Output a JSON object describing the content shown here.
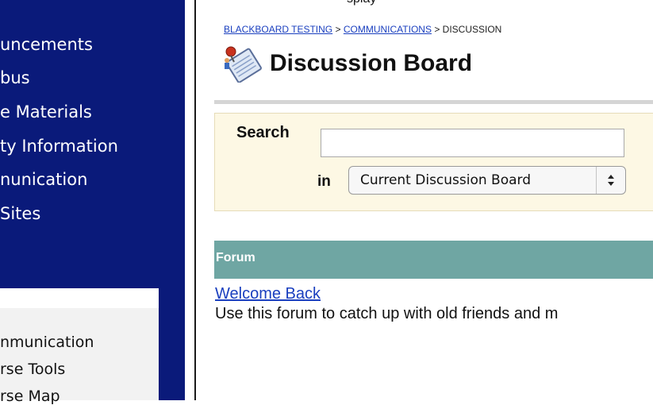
{
  "nav": {
    "items": [
      {
        "label": "uncements"
      },
      {
        "label": "bus"
      },
      {
        "label": "e Materials"
      },
      {
        "label": "ty Information"
      },
      {
        "label": "nunication"
      },
      {
        "label": "Sites"
      }
    ]
  },
  "tools": {
    "items": [
      {
        "label": "nmunication"
      },
      {
        "label": "rse Tools"
      },
      {
        "label": "rse Map"
      }
    ]
  },
  "top_cut": "splay",
  "breadcrumb": {
    "items": [
      "BLACKBOARD TESTING",
      "COMMUNICATIONS"
    ],
    "separator": ">",
    "current": "DISCUSSION"
  },
  "page": {
    "title": "Discussion Board",
    "icon": "discussion-board-icon"
  },
  "search": {
    "label": "Search",
    "value": "",
    "in_label": "in",
    "scope_selected": "Current Discussion Board"
  },
  "forum": {
    "header": "Forum",
    "rows": [
      {
        "title": "Welcome Back",
        "description": "Use this forum to catch up with old friends and m"
      }
    ]
  },
  "colors": {
    "nav_bg": "#0a1a7a",
    "forum_header_bg": "#6fa6a3",
    "search_panel_bg": "#fdf8e4",
    "link": "#1a3fbf"
  }
}
